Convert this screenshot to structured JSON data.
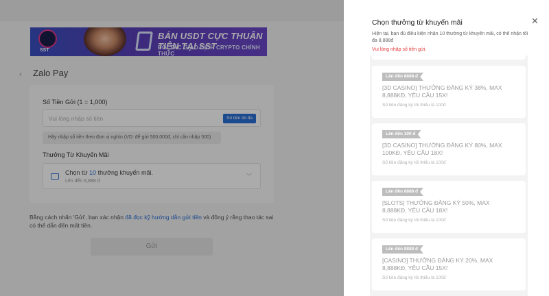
{
  "banner": {
    "logo_text": "SST",
    "headline": "BÁN USDT CỰC THUẬN TIỆN TẠI SST",
    "subline": "ĐỐI TÁC GIAO DỊCH CRYPTO CHÍNH THỨC"
  },
  "page": {
    "back_icon": "‹",
    "title": "Zalo Pay"
  },
  "form": {
    "amount_label": "Số Tiền Gửi (1 = 1,000)",
    "amount_placeholder": "Vui lòng nhập số tiền",
    "max_button": "Số tiền tối đa",
    "amount_hint": "Hãy nhập số tiền theo đơn vị nghìn (VD: để gửi 500,000đ, chỉ cần nhập 500)",
    "promo_label": "Thưởng Từ Khuyến Mãi",
    "promo_select": {
      "prefix": "Chọn từ ",
      "count": "10",
      "suffix": " thưởng khuyến mãi.",
      "sub": "Lên đến 8,888 đ"
    },
    "note_prefix": "Bằng cách nhấn 'Gửi', bạn xác nhận ",
    "note_link": "đã đọc kỹ hướng dẫn gửi tiền",
    "note_suffix": " và đồng ý rằng thao tác sai có thể dẫn đến mất tiền.",
    "submit": "Gửi"
  },
  "panel": {
    "title": "Chọn thưởng từ khuyến mãi",
    "close_icon": "✕",
    "info": "Hiện tại, bạn đủ điều kiện nhận 10 thưởng từ khuyến mãi, có thể nhận tối đa 8,888đ",
    "warning": "Vui lòng nhập số tiền gửi.",
    "items": [
      {
        "tag": "Lên đến 8888 đ",
        "name": "[3D CASINO] THƯỞNG ĐĂNG KÝ 38%, MAX 8,888KĐ, YÊU CẦU 15X!",
        "min": "Số tiền đăng ký tối thiểu là 100đ"
      },
      {
        "tag": "Lên đến 100 đ",
        "name": "[3D CASINO] THƯỞNG ĐĂNG KÝ 80%, MAX 100KĐ, YÊU CẦU 18X!",
        "min": "Số tiền đăng ký tối thiểu là 100đ"
      },
      {
        "tag": "Lên đến 8888 đ",
        "name": "[SLOTS] THƯỞNG ĐĂNG KÝ 50%, MAX 8,888KĐ, YÊU CẦU 18X!",
        "min": "Số tiền đăng ký tối thiểu là 100đ"
      },
      {
        "tag": "Lên đến 8888 đ",
        "name": "[CASINO] THƯỞNG ĐĂNG KÝ 20%, MAX 8,888KĐ, YÊU CẦU 15X!",
        "min": "Số tiền đăng ký tối thiểu là 100đ"
      }
    ]
  }
}
